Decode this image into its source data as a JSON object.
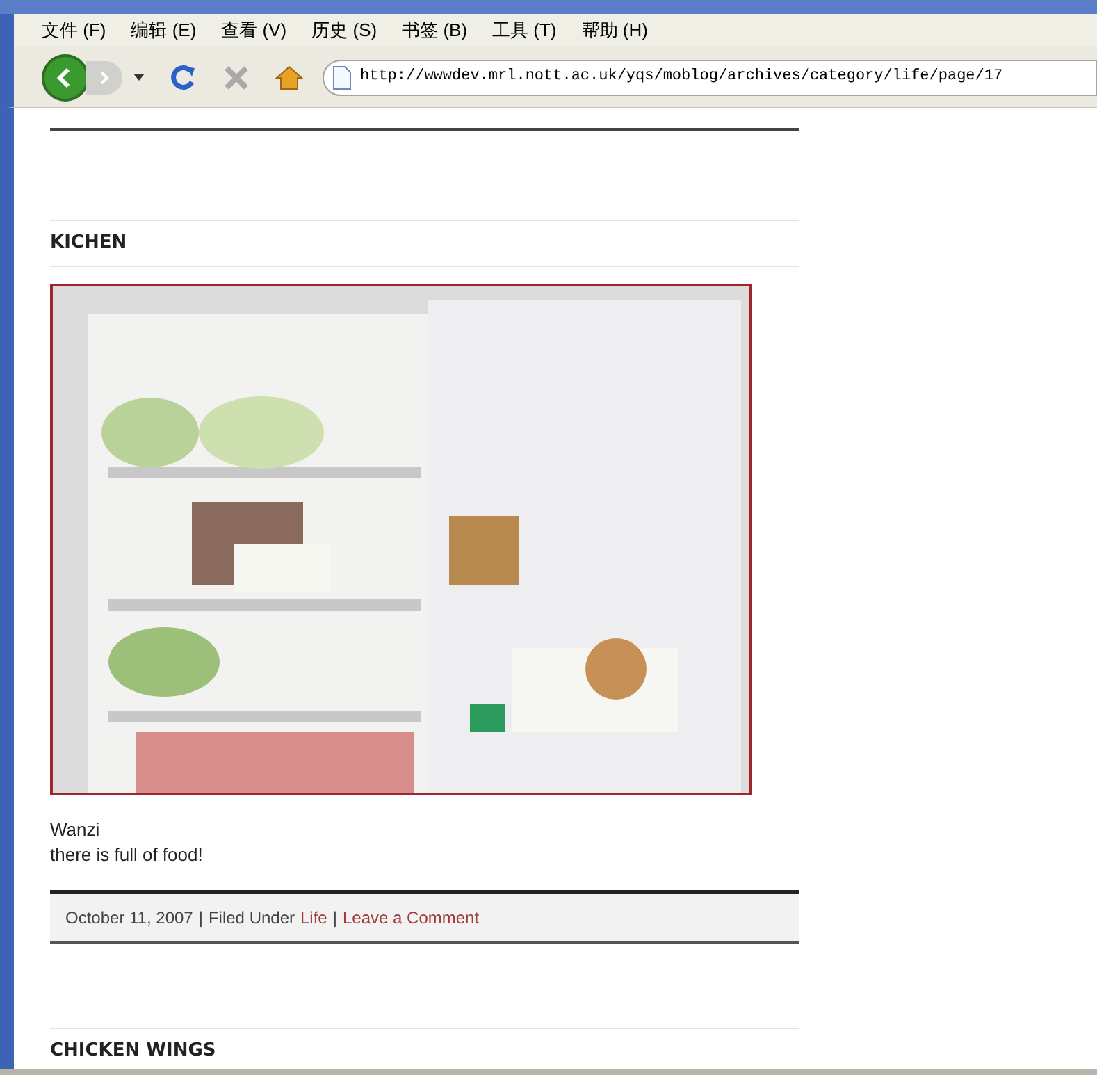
{
  "menu": [
    {
      "label": "文件",
      "key": "(F)"
    },
    {
      "label": "编辑",
      "key": "(E)"
    },
    {
      "label": "查看",
      "key": "(V)"
    },
    {
      "label": "历史",
      "key": "(S)"
    },
    {
      "label": "书签",
      "key": "(B)"
    },
    {
      "label": "工具",
      "key": "(T)"
    },
    {
      "label": "帮助",
      "key": "(H)"
    }
  ],
  "address": "http://wwwdev.mrl.nott.ac.uk/yqs/moblog/archives/category/life/page/17",
  "posts": [
    {
      "title": "KICHEN",
      "lines": [
        "Wanzi",
        "there is full of food!"
      ],
      "footer": {
        "date": "October 11, 2007",
        "separator_1": "|",
        "filed_under": "Filed Under",
        "category": "Life",
        "separator_2": "|",
        "comment_link": "Leave a Comment"
      }
    },
    {
      "title": "CHICKEN WINGS"
    }
  ]
}
